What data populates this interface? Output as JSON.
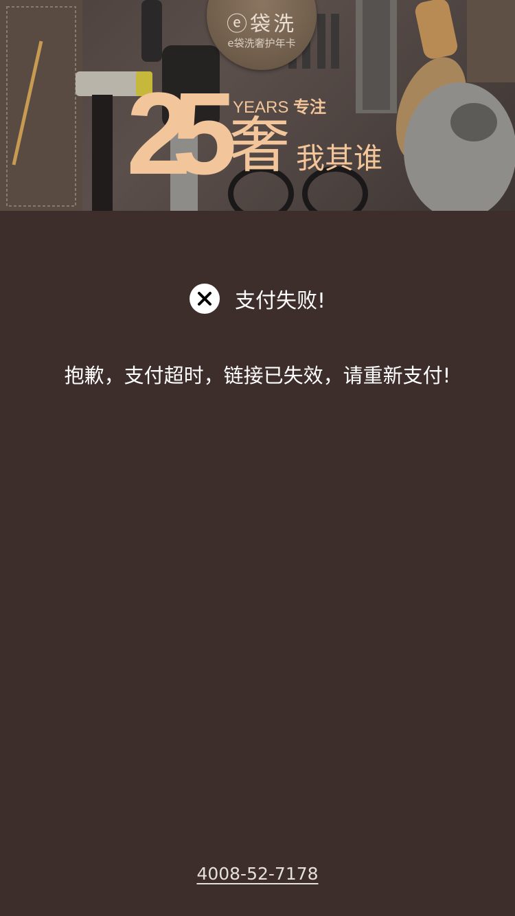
{
  "banner": {
    "logo_main": "ⓔ袋洗",
    "logo_sub": "e袋洗奢护年卡",
    "big_number": "25",
    "years_label": "YEARS",
    "years_suffix": "专注",
    "big_char": "奢",
    "slogan_tail": "我其谁"
  },
  "status": {
    "icon": "close-circle-icon",
    "title": "支付失败!",
    "message": "抱歉，支付超时，链接已失效，请重新支付!"
  },
  "footer": {
    "phone": "4008-52-7178"
  },
  "colors": {
    "background": "#3d2d2b",
    "accent": "#f2c59a",
    "text": "#ffffff"
  }
}
